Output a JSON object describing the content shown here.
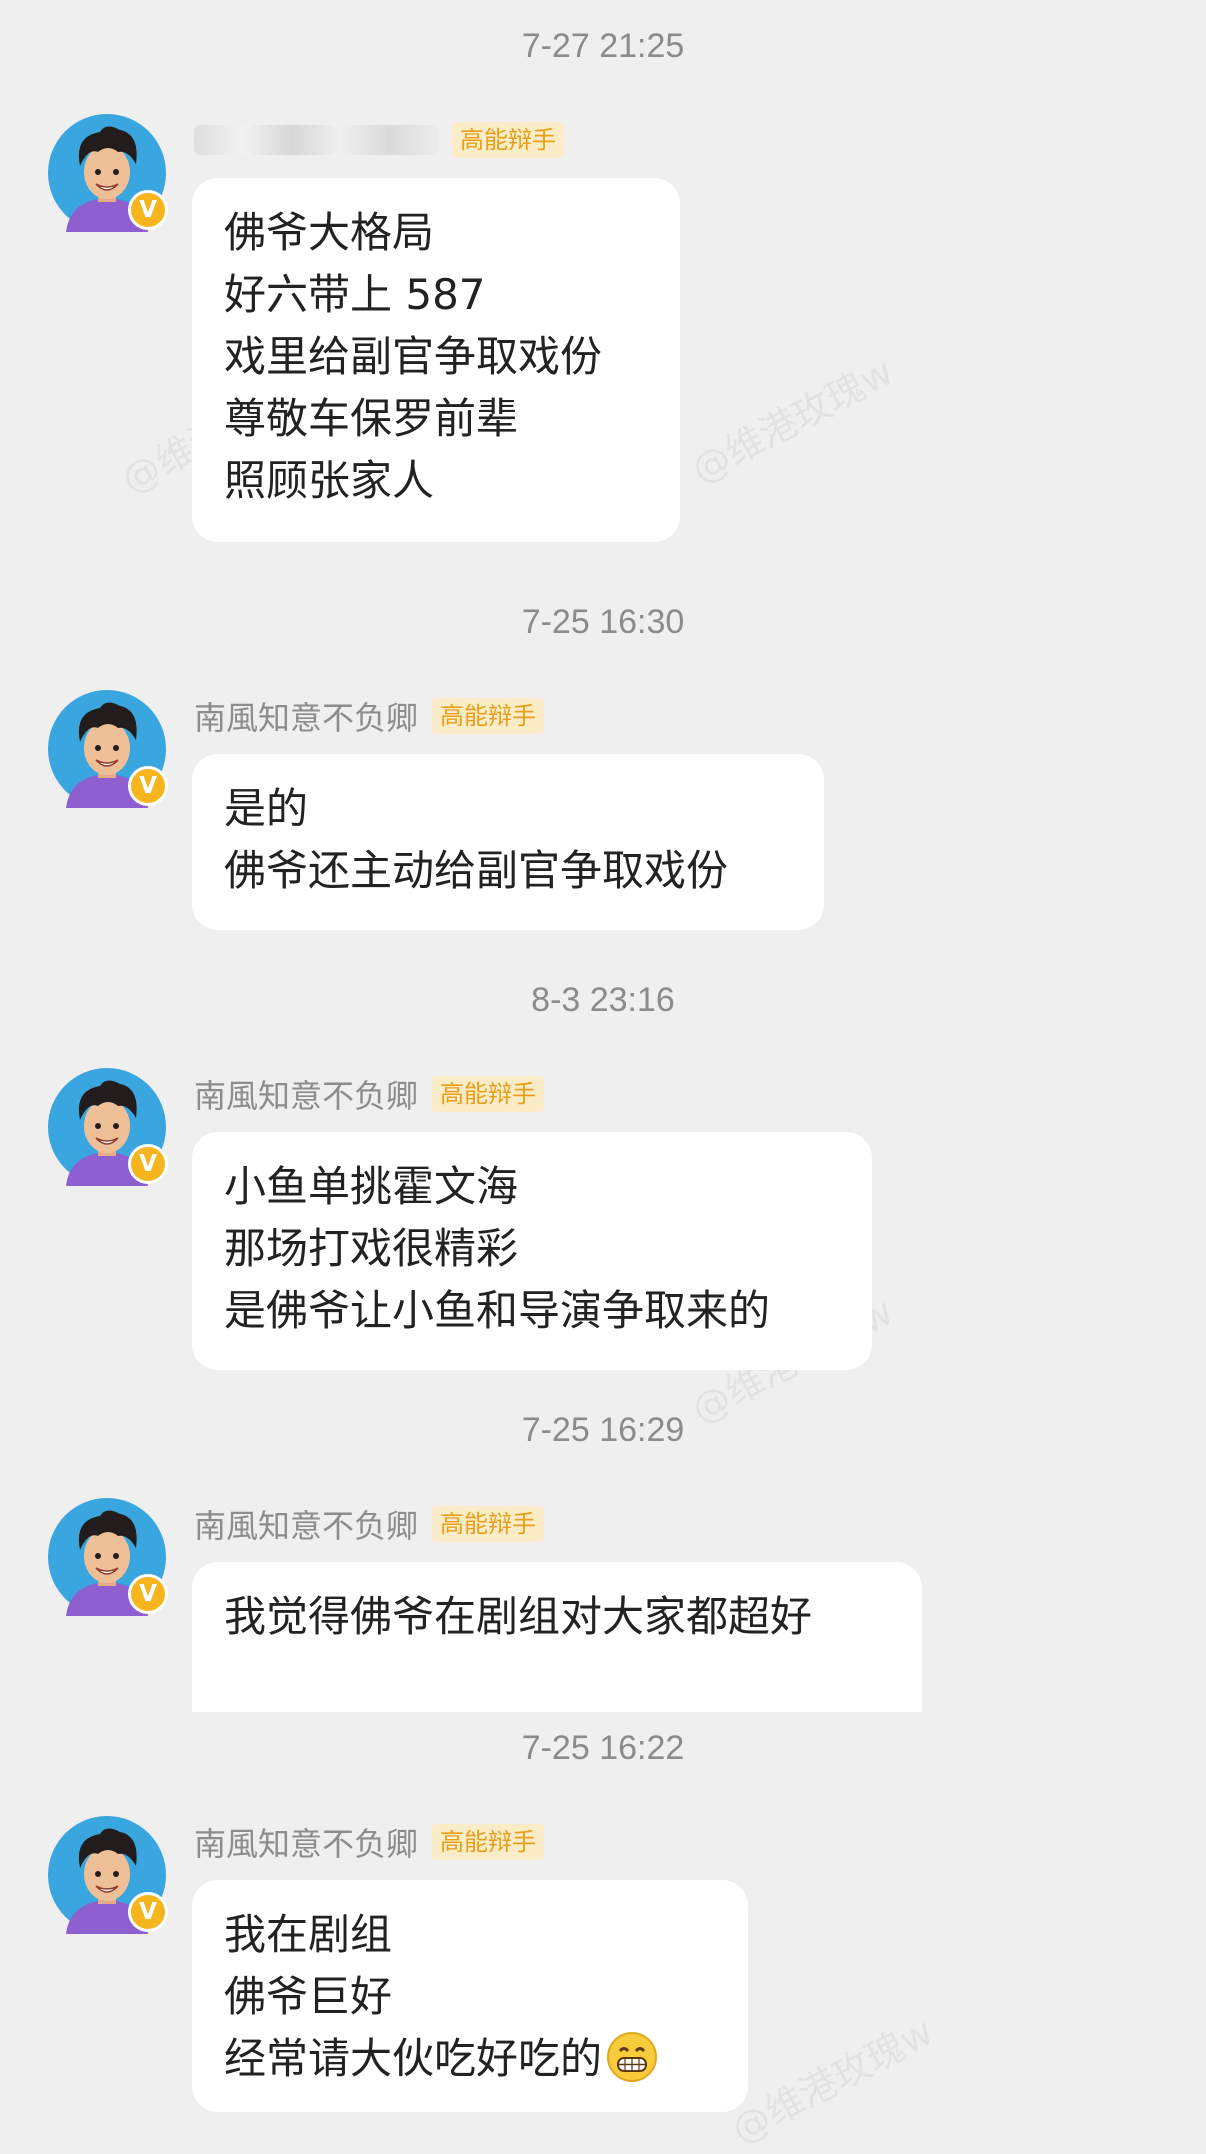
{
  "messages": [
    {
      "time": "7-27 21:25",
      "name": "",
      "tag": "高能辩手",
      "lines": [
        "佛爷大格局",
        "好六带上 587",
        "戏里给副官争取戏份",
        "尊敬车保罗前辈",
        "照顾张家人"
      ]
    },
    {
      "time": "7-25 16:30",
      "name": "南風知意不负卿",
      "tag": "高能辩手",
      "lines": [
        "是的",
        "佛爷还主动给副官争取戏份"
      ]
    },
    {
      "time": "8-3 23:16",
      "name": "南風知意不负卿",
      "tag": "高能辩手",
      "lines": [
        "小鱼单挑霍文海",
        "那场打戏很精彩",
        "是佛爷让小鱼和导演争取来的"
      ]
    },
    {
      "time": "7-25 16:29",
      "name": "南風知意不负卿",
      "tag": "高能辩手",
      "lines": [
        "我觉得佛爷在剧组对大家都超好"
      ]
    },
    {
      "time": "7-25 16:22",
      "name": "南風知意不负卿",
      "tag": "高能辩手",
      "lines": [
        "我在剧组",
        "佛爷巨好",
        "经常请大伙吃好吃的"
      ],
      "trailing_emoji": "grinning-face-emoji"
    }
  ],
  "badge_letter": "V",
  "watermark": "@维港玫瑰w",
  "colors": {
    "background": "#efefef",
    "bubble": "#ffffff",
    "tag_bg": "#fbecc8",
    "tag_text": "#e79f1a",
    "badge": "#f6b51c"
  }
}
